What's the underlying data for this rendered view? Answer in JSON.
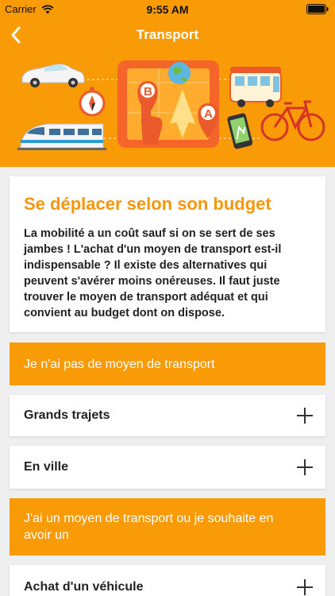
{
  "status_bar": {
    "carrier": "Carrier",
    "time": "9:55 AM"
  },
  "nav": {
    "title": "Transport"
  },
  "banner": {
    "pin_b": "B",
    "pin_a": "A"
  },
  "intro": {
    "title": "Se déplacer selon son budget",
    "text": "La mobilité a un coût sauf si on se sert de ses jambes ! L'achat d'un moyen de transport est-il indispensable ? Il existe des alternatives qui peuvent s'avérer moins onéreuses. Il faut juste trouver le moyen de transport adéquat et qui convient au budget dont on dispose."
  },
  "sections": [
    {
      "label": "Je n'ai pas de moyen de transport",
      "style": "header"
    },
    {
      "label": "Grands trajets",
      "style": "expandable"
    },
    {
      "label": "En ville",
      "style": "expandable"
    },
    {
      "label": "J'ai un moyen de transport ou je souhaite en avoir un",
      "style": "header"
    },
    {
      "label": "Achat d'un véhicule",
      "style": "expandable"
    }
  ],
  "colors": {
    "accent": "#f89b07",
    "title_accent": "#f6970b",
    "background": "#efefef"
  }
}
